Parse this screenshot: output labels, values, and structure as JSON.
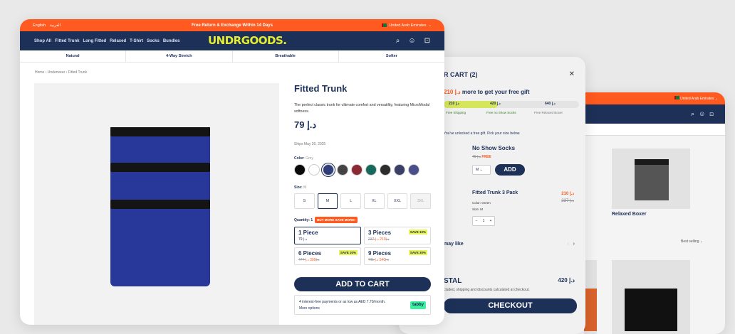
{
  "product_page": {
    "promo_bar": {
      "lang_en": "English",
      "lang_ar": "العربية",
      "message": "Free Return & Exchange Within 14 Days",
      "region": "United Arab Emirates"
    },
    "nav": {
      "links": [
        "Shop All",
        "Fitted Trunk",
        "Long Fitted",
        "Relaxed",
        "T-Shirt",
        "Socks",
        "Bundles"
      ],
      "logo": "UNDRGOODS."
    },
    "features": [
      "Natural",
      "4-Way Stretch",
      "Breathable",
      "Softer"
    ],
    "breadcrumb": "Home  ›  Underwear  ›  Fitted Trunk",
    "product": {
      "title": "Fitted Trunk",
      "description": "The perfect classic trunk for ultimate comfort and versatility, featuring MicroModal softness.",
      "price": "79 د.إ",
      "ships": "Ships May 26, 2025",
      "color_label": "Color:",
      "color_value": "Grey",
      "swatches": [
        "#0a0a0a",
        "#ffffff",
        "#2f3d78",
        "#444444",
        "#8a2a35",
        "#166a5b",
        "#2d2d2d",
        "#3a3f66",
        "#4a4f8a"
      ],
      "size_label": "Size:",
      "size_value": "M",
      "sizes": [
        "S",
        "M",
        "L",
        "XL",
        "XXL",
        "3XL"
      ],
      "quantity_label": "Quantity: 1",
      "buy_more": "BUY MORE SAVE MORE!",
      "packs": [
        {
          "name": "1 Piece",
          "old": "",
          "new": "79 د.إ",
          "save": ""
        },
        {
          "name": "3 Pieces",
          "old": "237 د.إ",
          "new": "210 د.إ",
          "save": "SAVE 10%"
        },
        {
          "name": "6 Pieces",
          "old": "474 د.إ",
          "new": "390 د.إ",
          "save": "SAVE 20%"
        },
        {
          "name": "9 Pieces",
          "old": "711 د.إ",
          "new": "540 د.إ",
          "save": "SAVE 30%"
        }
      ],
      "add_to_cart": "ADD TO CART",
      "tabby_text": "4 interest-free payments or as low as AED 7.70/month.",
      "tabby_more": "More options",
      "tabby_badge": "tabby"
    }
  },
  "cart_drawer": {
    "title": "R CART (2)",
    "gift_amount": "210 د.إ",
    "gift_text": "more to get your free gift",
    "progress": 0.4,
    "milestones": [
      "210 د.إ",
      "420 د.إ",
      "640 د.إ"
    ],
    "milestone_labels": [
      "Free Shipping",
      "Free no Show Socks",
      "Free Relaxed Boxer"
    ],
    "unlock_text": "You've unlocked a free gift. Pick your size below.",
    "gift_item": {
      "name": "No Show Socks",
      "old": "49 د.إ",
      "free": "FREE",
      "size": "M",
      "add": "ADD"
    },
    "line_item": {
      "name": "Fitted Trunk 3 Pack",
      "color": "Color: Green",
      "size": "Size: M",
      "price_new": "210 د.إ",
      "price_old": "237 د.إ",
      "qty": "1"
    },
    "may_like": "may like",
    "subtotal_label": "STAL",
    "subtotal_value": "420 د.إ",
    "subtotal_note": "cluded, shipping and discounts calculated at checkout.",
    "checkout": "CHECKOUT"
  },
  "collection_page": {
    "region": "United Arab Emirates",
    "feature": "Softer",
    "card_title": "Relaxed Boxer",
    "sort": "Best selling"
  }
}
